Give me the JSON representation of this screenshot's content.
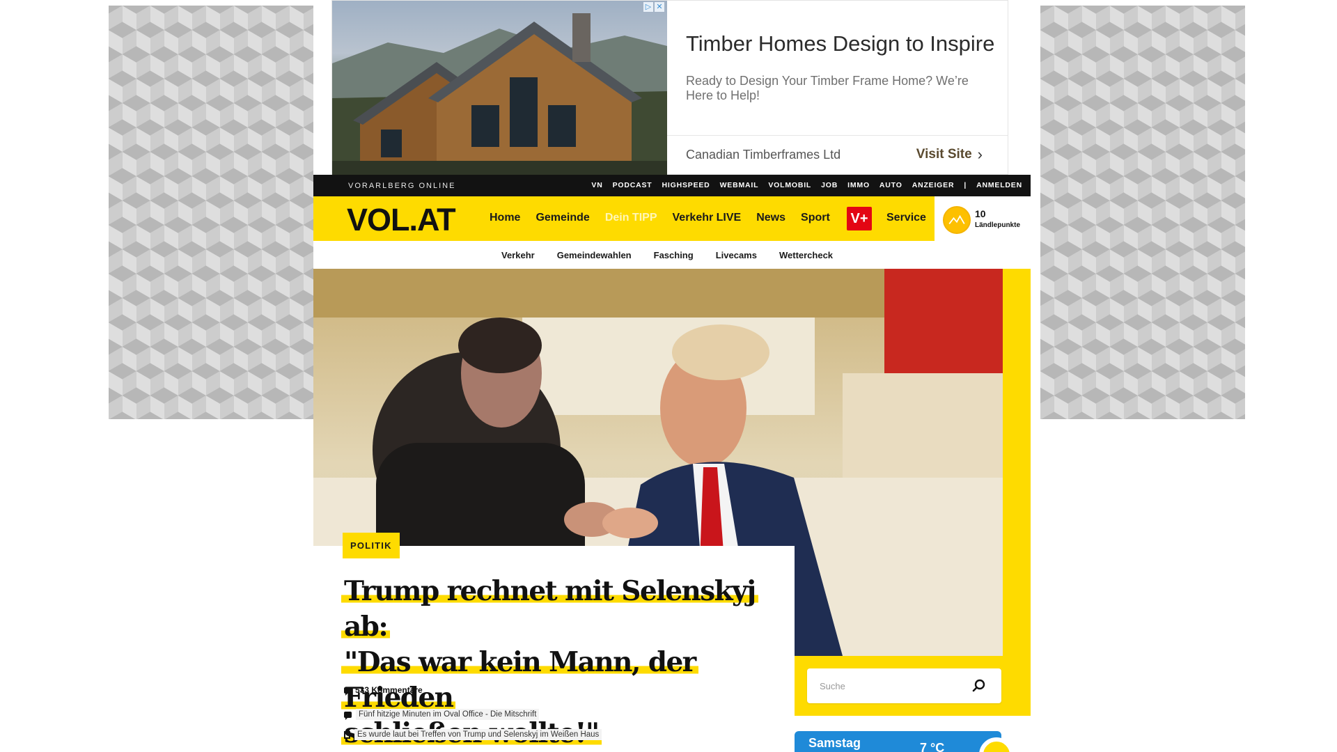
{
  "ad": {
    "title": "Timber Homes Design to Inspire",
    "description": "Ready to Design Your Timber Frame Home? We’re Here to Help!",
    "sponsor": "Canadian Timberframes Ltd",
    "cta": "Visit Site",
    "badge_info": "▷",
    "badge_close": "✕"
  },
  "topbar": {
    "brand": "VORARLBERG ONLINE",
    "links": [
      "VN",
      "PODCAST",
      "HIGHSPEED",
      "WEBMAIL",
      "VOLMOBIL",
      "JOB",
      "IMMO",
      "AUTO",
      "ANZEIGER",
      "|",
      "ANMELDEN"
    ]
  },
  "header": {
    "logo": "VOL.AT",
    "nav": [
      "Home",
      "Gemeinde",
      "Dein TIPP",
      "Verkehr LIVE",
      "News",
      "Sport"
    ],
    "vplus": "V+",
    "service": "Service",
    "points": {
      "count": "10",
      "label": "Ländlepunkte"
    }
  },
  "subnav": [
    "Verkehr",
    "Gemeindewahlen",
    "Fasching",
    "Livecams",
    "Wettercheck"
  ],
  "article": {
    "category": "POLITIK",
    "headline_lines": [
      "Trump rechnet mit Selenskyj ab:",
      "\"Das war kein Mann, der Frieden",
      "schließen wollte!\""
    ],
    "comments": "533 Kommentare",
    "related": [
      {
        "icon": "comment-icon",
        "text": "Fünf hitzige Minuten im Oval Office - Die Mitschrift"
      },
      {
        "icon": "document-icon",
        "text": "Es wurde laut bei Treffen von Trump und Selenskyj im Weißen Haus"
      }
    ]
  },
  "search": {
    "placeholder": "Suche",
    "icon": "search-icon"
  },
  "weather": {
    "day": "Samstag",
    "temp": "7 °C"
  },
  "colors": {
    "brand_yellow": "#fedb00",
    "vplus_red": "#e30613",
    "weather_blue": "#1f8ad8"
  }
}
